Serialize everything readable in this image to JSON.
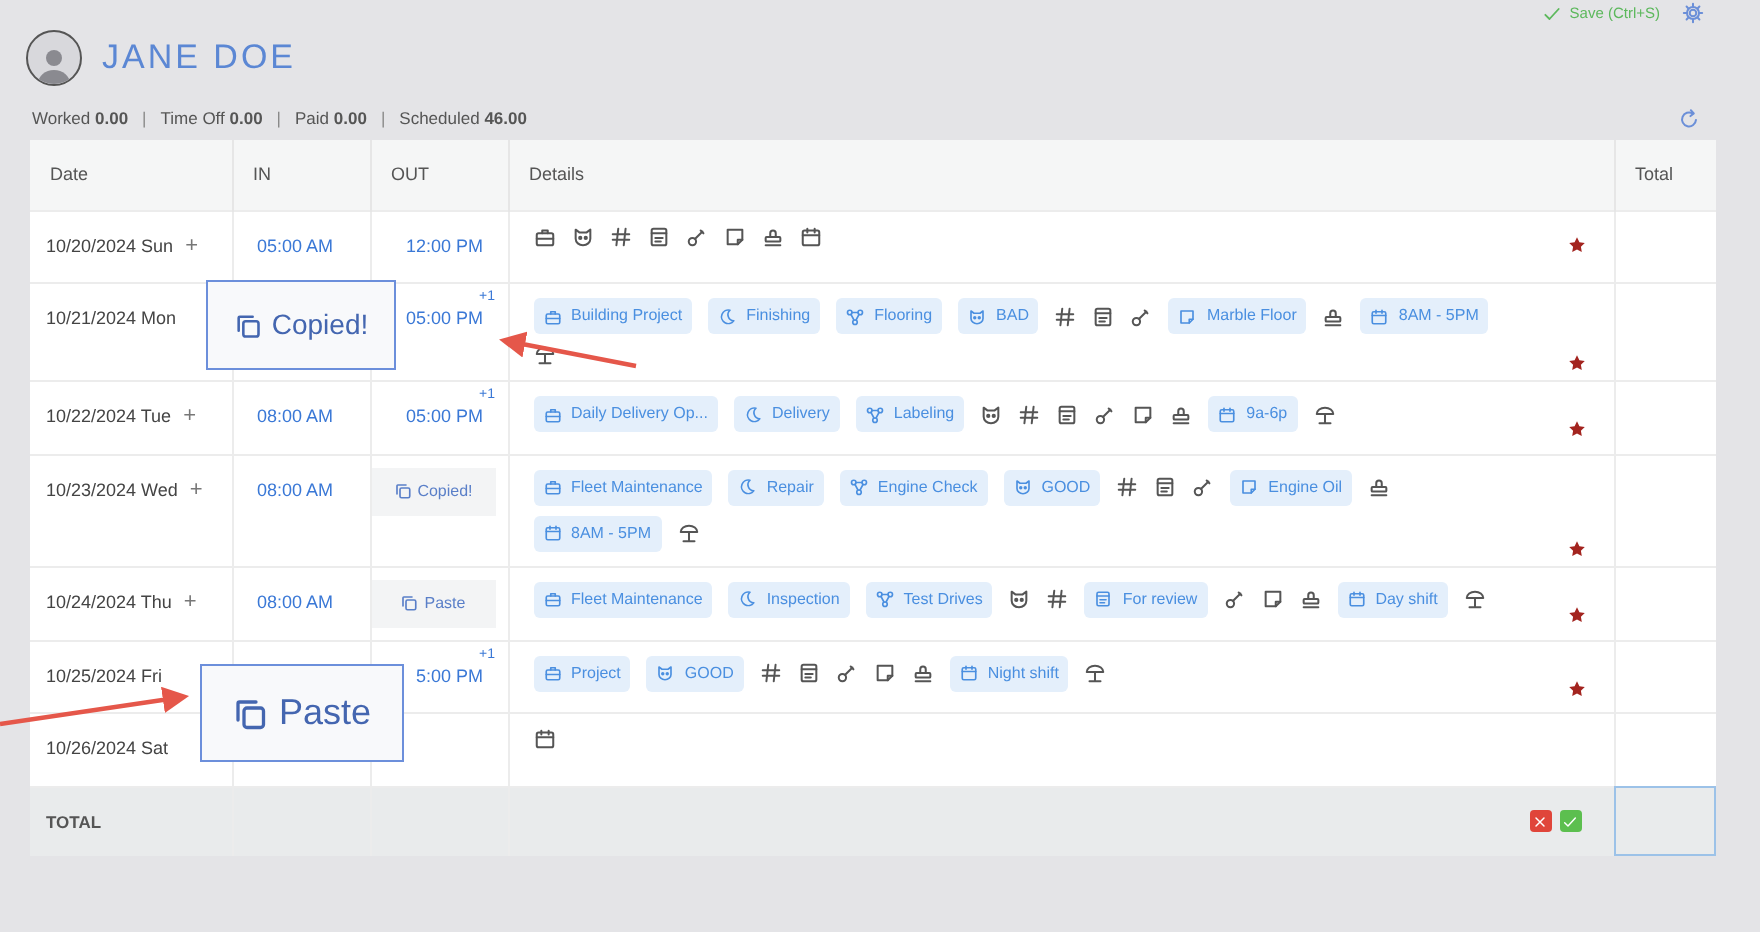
{
  "header": {
    "name": "JANE DOE",
    "save_label": "Save (Ctrl+S)"
  },
  "summary": [
    {
      "label": "Worked",
      "value": "0.00"
    },
    {
      "separator": "|",
      "label": "Time Off",
      "value": "0.00"
    },
    {
      "separator": "|",
      "label": "Paid",
      "value": "0.00"
    },
    {
      "separator": "|",
      "label": "Scheduled",
      "value": "46.00"
    }
  ],
  "table": {
    "columns": [
      "Date",
      "IN",
      "OUT",
      "Details",
      "Total"
    ],
    "rows": [
      {
        "date": "10/20/2024 Sun",
        "add": "+",
        "in": "05:00 AM",
        "out": {
          "kind": "time",
          "text": "12:00 PM"
        },
        "flagged": true,
        "details": [
          {
            "kind": "briefcase"
          },
          {
            "kind": "face"
          },
          {
            "kind": "hash"
          },
          {
            "kind": "form"
          },
          {
            "kind": "key"
          },
          {
            "kind": "note"
          },
          {
            "kind": "stamp"
          },
          {
            "kind": "calendar"
          }
        ]
      },
      {
        "date": "10/21/2024 Mon",
        "out": {
          "kind": "time",
          "text": "05:00 PM",
          "next_day": "+1"
        },
        "flagged": true,
        "details": [
          {
            "kind": "briefcase",
            "label": "Building Project"
          },
          {
            "kind": "moon",
            "label": "Finishing"
          },
          {
            "kind": "nodes",
            "label": "Flooring"
          },
          {
            "kind": "face",
            "label": "BAD"
          },
          {
            "kind": "hash"
          },
          {
            "kind": "form"
          },
          {
            "kind": "key"
          },
          {
            "kind": "note",
            "label": "Marble Floor"
          },
          {
            "kind": "stamp"
          },
          {
            "kind": "calendar",
            "label": "8AM - 5PM"
          },
          {
            "kind": "umbrella"
          }
        ]
      },
      {
        "date": "10/22/2024 Tue",
        "add": "+",
        "in": "08:00 AM",
        "out": {
          "kind": "time",
          "text": "05:00 PM",
          "next_day": "+1"
        },
        "flagged": true,
        "details": [
          {
            "kind": "briefcase",
            "label": "Daily Delivery Op..."
          },
          {
            "kind": "moon",
            "label": "Delivery"
          },
          {
            "kind": "nodes",
            "label": "Labeling"
          },
          {
            "kind": "face"
          },
          {
            "kind": "hash"
          },
          {
            "kind": "form"
          },
          {
            "kind": "key"
          },
          {
            "kind": "note"
          },
          {
            "kind": "stamp"
          },
          {
            "kind": "calendar",
            "label": "9a-6p"
          },
          {
            "kind": "umbrella"
          }
        ]
      },
      {
        "date": "10/23/2024 Wed",
        "add": "+",
        "in": "08:00 AM",
        "out": {
          "kind": "copied",
          "text": "Copied!"
        },
        "flagged": true,
        "details": [
          {
            "kind": "briefcase",
            "label": "Fleet Maintenance"
          },
          {
            "kind": "moon",
            "label": "Repair"
          },
          {
            "kind": "nodes",
            "label": "Engine Check"
          },
          {
            "kind": "face",
            "label": "GOOD"
          },
          {
            "kind": "hash"
          },
          {
            "kind": "form"
          },
          {
            "kind": "key"
          },
          {
            "kind": "note",
            "label": "Engine Oil"
          },
          {
            "kind": "stamp"
          },
          {
            "kind": "calendar",
            "label": "8AM - 5PM"
          },
          {
            "kind": "umbrella"
          }
        ]
      },
      {
        "date": "10/24/2024 Thu",
        "add": "+",
        "in": "08:00 AM",
        "out": {
          "kind": "paste",
          "text": "Paste"
        },
        "flagged": true,
        "details": [
          {
            "kind": "briefcase",
            "label": "Fleet Maintenance"
          },
          {
            "kind": "moon",
            "label": "Inspection"
          },
          {
            "kind": "nodes",
            "label": "Test Drives"
          },
          {
            "kind": "face"
          },
          {
            "kind": "hash"
          },
          {
            "kind": "form",
            "label": "For review"
          },
          {
            "kind": "key"
          },
          {
            "kind": "note"
          },
          {
            "kind": "stamp"
          },
          {
            "kind": "calendar",
            "label": "Day shift"
          },
          {
            "kind": "umbrella"
          }
        ]
      },
      {
        "date": "10/25/2024 Fri",
        "out": {
          "kind": "time",
          "text": "5:00 PM",
          "next_day": "+1"
        },
        "flagged": true,
        "details": [
          {
            "kind": "briefcase",
            "label": "Project"
          },
          {
            "kind": "face",
            "label": "GOOD"
          },
          {
            "kind": "hash"
          },
          {
            "kind": "form"
          },
          {
            "kind": "key"
          },
          {
            "kind": "note"
          },
          {
            "kind": "stamp"
          },
          {
            "kind": "calendar",
            "label": "Night shift"
          },
          {
            "kind": "umbrella"
          }
        ]
      },
      {
        "date": "10/26/2024 Sat",
        "flagged": false,
        "details": [
          {
            "kind": "calendar"
          }
        ]
      }
    ],
    "total_row": {
      "label": "TOTAL",
      "total_selected": true
    }
  },
  "callouts": [
    {
      "kind": "copied",
      "text": "Copied!"
    },
    {
      "kind": "paste",
      "text": "Paste"
    }
  ]
}
